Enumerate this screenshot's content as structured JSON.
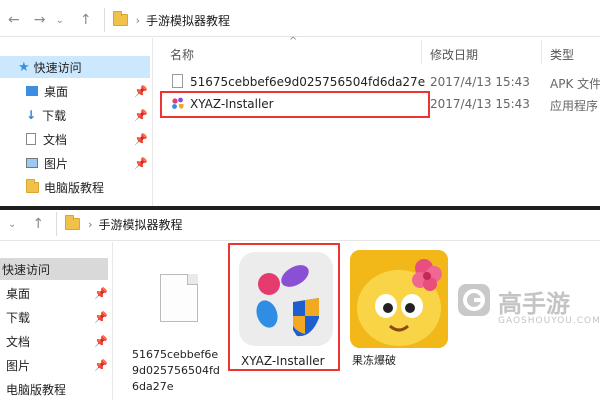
{
  "top_window": {
    "breadcrumb": "手游模拟器教程",
    "columns": {
      "name": "名称",
      "date": "修改日期",
      "type": "类型"
    },
    "files": [
      {
        "name": "51675cebbef6e9d025756504fd6da27e",
        "date": "2017/4/13 15:43",
        "type": "APK 文件"
      },
      {
        "name": "XYAZ-Installer",
        "date": "2017/4/13 15:43",
        "type": "应用程序"
      }
    ],
    "sidebar": [
      {
        "label": "快速访问"
      },
      {
        "label": "桌面"
      },
      {
        "label": "下载"
      },
      {
        "label": "文档"
      },
      {
        "label": "图片"
      },
      {
        "label": "电脑版教程"
      }
    ]
  },
  "bottom_window": {
    "breadcrumb": "手游模拟器教程",
    "sidebar": [
      {
        "label": "快速访问"
      },
      {
        "label": "桌面"
      },
      {
        "label": "下载"
      },
      {
        "label": "文档"
      },
      {
        "label": "图片"
      },
      {
        "label": "电脑版教程"
      }
    ],
    "items": [
      {
        "label_lines": [
          "51675cebbef6e",
          "9d025756504fd",
          "6da27e"
        ]
      },
      {
        "label": "XYAZ-Installer"
      },
      {
        "label": "果冻爆破"
      }
    ]
  },
  "watermark": {
    "brand": "高手游",
    "url": "GAOSHOUYOU.COM"
  }
}
